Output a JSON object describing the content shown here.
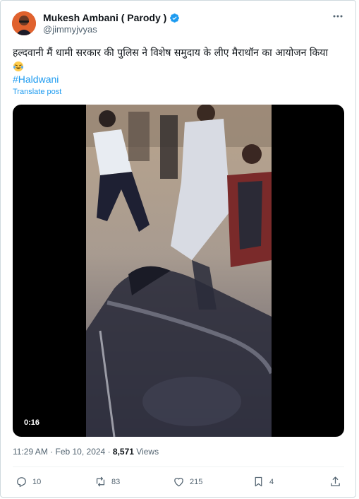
{
  "author": {
    "name": "Mukesh Ambani ( Parody )",
    "handle": "@jimmyjvyas",
    "avatar_icon": "avatar-portrait-icon",
    "verified_icon": "verified-badge-icon",
    "verified_color": "#1d9bf0"
  },
  "post": {
    "text": "हल्दवानी मैं धामी सरकार की पुलिस ने विशेष समुदाय के लीए मैराथॉन का आयोजन किया",
    "emoji_icon": "laughing-face-emoji-icon",
    "hashtag": "#Haldwani",
    "translate_label": "Translate post"
  },
  "media": {
    "duration": "0:16",
    "play_icon": "video-icon"
  },
  "meta": {
    "time": "11:29 AM",
    "separator": "·",
    "date": "Feb 10, 2024",
    "views_count": "8,571",
    "views_label": "Views"
  },
  "actions": {
    "replies": "10",
    "reposts": "83",
    "likes": "215",
    "bookmarks": "4"
  },
  "colors": {
    "accent": "#1d9bf0",
    "text": "#0f1419",
    "muted": "#536471",
    "border": "#cfd9de"
  }
}
